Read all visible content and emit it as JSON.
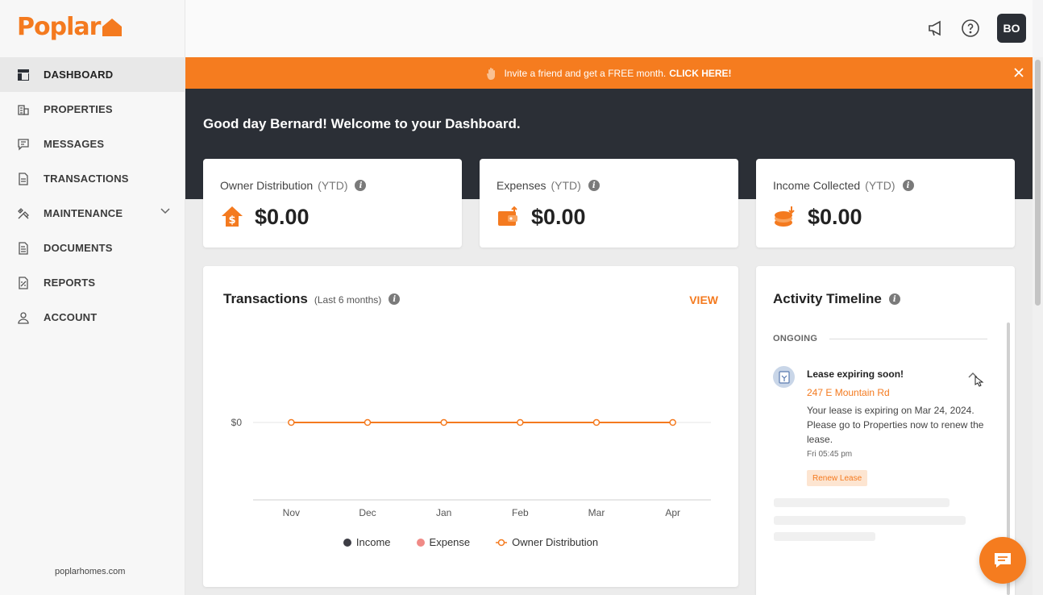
{
  "brand": {
    "name": "Poplar",
    "color": "#f47a1f",
    "footer_link": "poplarhomes.com"
  },
  "sidebar": {
    "items": [
      {
        "label": "DASHBOARD",
        "icon": "dashboard-icon",
        "active": true
      },
      {
        "label": "PROPERTIES",
        "icon": "building-icon"
      },
      {
        "label": "MESSAGES",
        "icon": "message-icon"
      },
      {
        "label": "TRANSACTIONS",
        "icon": "document-icon"
      },
      {
        "label": "MAINTENANCE",
        "icon": "tools-icon",
        "expandable": true
      },
      {
        "label": "DOCUMENTS",
        "icon": "file-icon"
      },
      {
        "label": "REPORTS",
        "icon": "report-icon"
      },
      {
        "label": "ACCOUNT",
        "icon": "user-icon"
      }
    ]
  },
  "header": {
    "avatar_initials": "BO",
    "icons": [
      "megaphone-icon",
      "help-icon"
    ]
  },
  "banner": {
    "text": "Invite a friend and get a FREE month.",
    "cta": "CLICK HERE!"
  },
  "hero": {
    "greeting": "Good day Bernard! Welcome to your Dashboard."
  },
  "stats": [
    {
      "label": "Owner Distribution",
      "period": "(YTD)",
      "value": "$0.00",
      "icon": "house-dollar-icon"
    },
    {
      "label": "Expenses",
      "period": "(YTD)",
      "value": "$0.00",
      "icon": "wallet-icon"
    },
    {
      "label": "Income Collected",
      "period": "(YTD)",
      "value": "$0.00",
      "icon": "coins-icon"
    }
  ],
  "transactions": {
    "title": "Transactions",
    "subtitle": "(Last 6 months)",
    "view_label": "VIEW",
    "y_tick_label": "$0",
    "legend": [
      "Income",
      "Expense",
      "Owner Distribution"
    ]
  },
  "chart_data": {
    "type": "line",
    "categories": [
      "Nov",
      "Dec",
      "Jan",
      "Feb",
      "Mar",
      "Apr"
    ],
    "series": [
      {
        "name": "Owner Distribution",
        "values": [
          0,
          0,
          0,
          0,
          0,
          0
        ],
        "color": "#f47a1f"
      }
    ],
    "legend": [
      {
        "name": "Income",
        "color": "#3d3d45"
      },
      {
        "name": "Expense",
        "color": "#f08a86"
      },
      {
        "name": "Owner Distribution",
        "color": "#f47a1f"
      }
    ],
    "yticks": [
      "$0"
    ],
    "grid": true,
    "legend_position": "bottom"
  },
  "activity": {
    "title": "Activity Timeline",
    "section": "ONGOING",
    "event": {
      "title": "Lease expiring soon!",
      "address": "247 E Mountain Rd",
      "body": "Your lease is expiring on Mar 24, 2024. Please go to Properties now to renew the lease.",
      "time": "Fri 05:45 pm",
      "action": "Renew Lease"
    }
  }
}
